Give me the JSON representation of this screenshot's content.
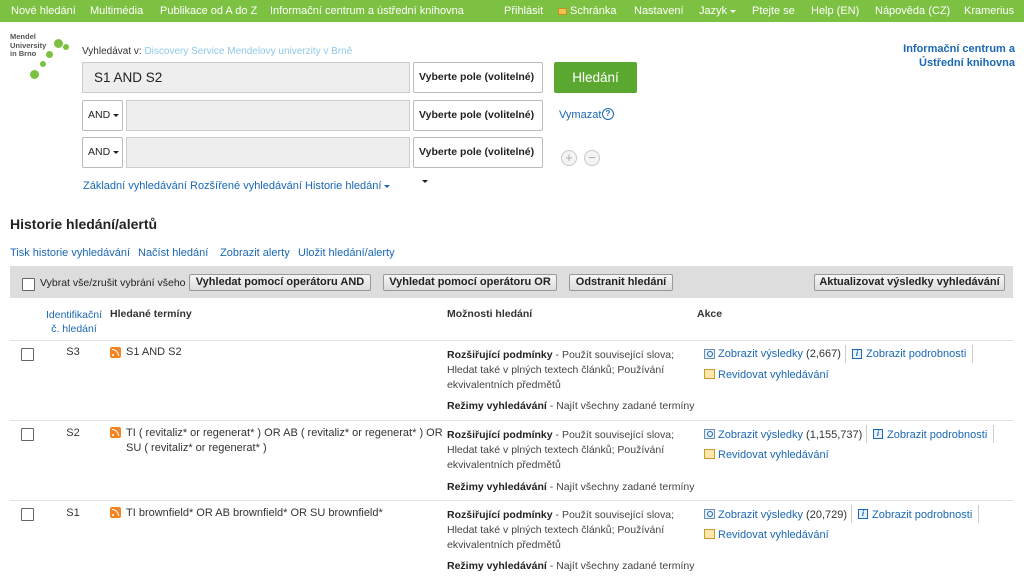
{
  "colors": {
    "nav_green": "#7cc142",
    "search_button": "#5ba830",
    "link_blue": "#1a68b4",
    "source_blue": "#8fc9e8",
    "rss_orange": "#f78422"
  },
  "topnav": {
    "left": [
      "Nové hledání",
      "Multimédia",
      "Publikace od A do Z",
      "Informační centrum a ústřední knihovna"
    ],
    "right": [
      "Přihlásit",
      "Schránka",
      "Nastavení",
      "Jazyk",
      "Ptejte se",
      "Help (EN)",
      "Nápověda (CZ)",
      "Kramerius"
    ]
  },
  "logo": {
    "line1": "Mendel",
    "line2": "University",
    "line3": "in Brno"
  },
  "search": {
    "search_in_label": "Vyhledávat v:",
    "search_in_source": "Discovery Service Mendelovy univerzity v Brně",
    "query": "S1 AND S2",
    "field_select": "Vyberte pole (volitelné)",
    "operator": "AND",
    "search_button": "Hledání",
    "clear": "Vymazat",
    "help_icon": "?",
    "add_row_icon": "+",
    "remove_row_icon": "−",
    "basic": "Základní vyhledávání",
    "advanced": "Rozšířené vyhledávání",
    "history": "Historie hledání"
  },
  "library_link": {
    "line1": "Informační centrum a",
    "line2": "Ústřední knihovna"
  },
  "history": {
    "title": "Historie hledání/alertů",
    "links": [
      "Tisk historie vyhledávání",
      "Načíst hledání",
      "Zobrazit alerty",
      "Uložit hledání/alerty"
    ],
    "select_all": "Vybrat vše/zrušit vybrání všeho",
    "buttons": {
      "and": "Vyhledat pomocí operátoru AND",
      "or": "Vyhledat pomocí operátoru OR",
      "remove": "Odstranit hledání",
      "refresh": "Aktualizovat výsledky vyhledávání"
    },
    "columns": {
      "id_line1": "Identifikační",
      "id_line2": "č. hledání",
      "terms": "Hledané termíny",
      "options": "Možnosti hledání",
      "actions": "Akce"
    },
    "option_label": "Rozšiřující podmínky",
    "option_text": "Použít související slova; Hledat také v plných textech článků; Používání ekvivalentních předmětů",
    "mode_label": "Režimy vyhledávání",
    "mode_text": "Najít všechny zadané termíny",
    "show_results": "Zobrazit výsledky",
    "show_details": "Zobrazit podrobnosti",
    "revise": "Revidovat vyhledávání",
    "info_icon": "i",
    "rows": [
      {
        "id": "S3",
        "term": "S1 AND S2",
        "count": "(2,667)"
      },
      {
        "id": "S2",
        "term": "TI ( revitaliz* or regenerat* ) OR AB ( revitaliz* or regenerat* ) OR SU ( revitaliz* or regenerat* )",
        "count": "(1,155,737)"
      },
      {
        "id": "S1",
        "term": "TI brownfield* OR AB brownfield* OR SU brownfield*",
        "count": "(20,729)"
      }
    ]
  }
}
